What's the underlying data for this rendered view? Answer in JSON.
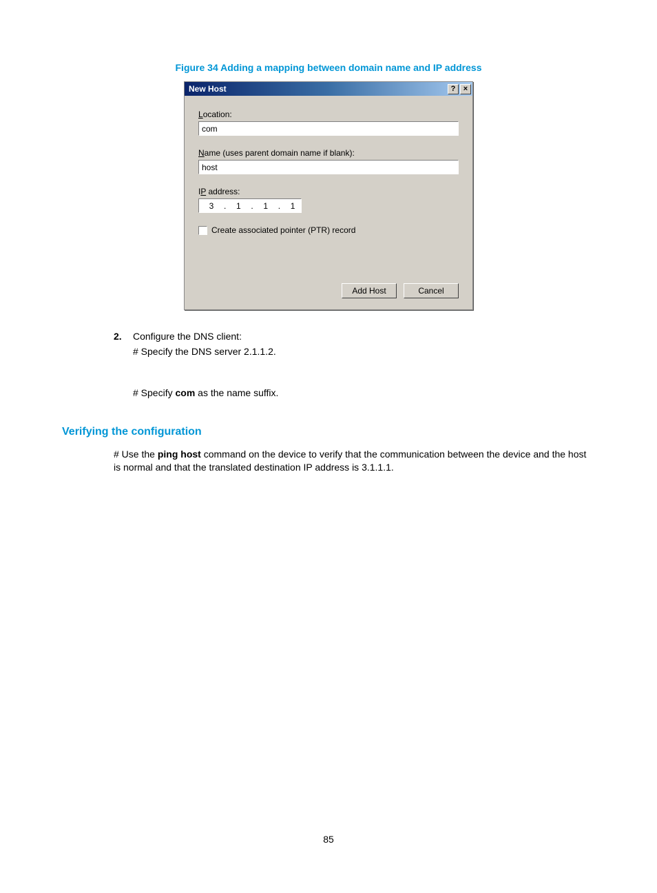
{
  "figure_caption": "Figure 34 Adding a mapping between domain name and IP address",
  "dialog": {
    "title": "New Host",
    "help": "?",
    "close": "×",
    "location_label_pre": "L",
    "location_label_rest": "ocation:",
    "location_value": "com",
    "name_label_pre": "N",
    "name_label_rest": "ame (uses parent domain name if blank):",
    "name_value": "host",
    "ip_label_pre": "I",
    "ip_label_mid": "P",
    "ip_label_rest": " address:",
    "ip1": "3",
    "ip2": "1",
    "ip3": "1",
    "ip4": "1",
    "ptr_pre": "C",
    "ptr_rest": "reate associated pointer (PTR) record",
    "add_pre": "Add ",
    "add_ul": "H",
    "add_rest": "ost",
    "cancel": "Cancel"
  },
  "step2": {
    "num": "2.",
    "text": "Configure the DNS client:",
    "line1": "# Specify the DNS server 2.1.1.2.",
    "line2_pre": "# Specify ",
    "line2_bold": "com",
    "line2_rest": " as the name suffix."
  },
  "section_heading": "Verifying the configuration",
  "verify": {
    "pre": "# Use the ",
    "bold1": "ping host",
    "rest": " command on the device to verify that the communication between the device and the host is normal and that the translated destination IP address is 3.1.1.1."
  },
  "page_number": "85"
}
